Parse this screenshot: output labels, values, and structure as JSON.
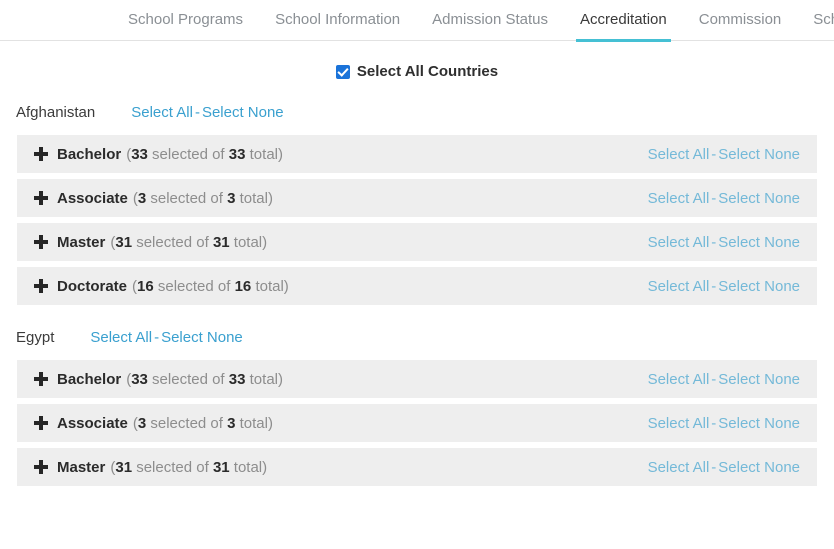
{
  "tabs": [
    {
      "label": "School Programs",
      "active": false
    },
    {
      "label": "School Information",
      "active": false
    },
    {
      "label": "Admission Status",
      "active": false
    },
    {
      "label": "Accreditation",
      "active": true
    },
    {
      "label": "Commission",
      "active": false
    },
    {
      "label": "Scholarship",
      "active": false
    }
  ],
  "select_all_countries": {
    "label": "Select All Countries",
    "checked": true
  },
  "links": {
    "select_all": "Select All",
    "select_none": "Select None",
    "separator": "-"
  },
  "countries": [
    {
      "name": "Afghanistan",
      "programs": [
        {
          "name": "Bachelor",
          "selected": "33",
          "total": "33"
        },
        {
          "name": "Associate",
          "selected": "3",
          "total": "3"
        },
        {
          "name": "Master",
          "selected": "31",
          "total": "31"
        },
        {
          "name": "Doctorate",
          "selected": "16",
          "total": "16"
        }
      ]
    },
    {
      "name": "Egypt",
      "programs": [
        {
          "name": "Bachelor",
          "selected": "33",
          "total": "33"
        },
        {
          "name": "Associate",
          "selected": "3",
          "total": "3"
        },
        {
          "name": "Master",
          "selected": "31",
          "total": "31"
        }
      ]
    }
  ],
  "count_text": {
    "open_paren": "(",
    "selected_of": " selected of ",
    "total_suffix": " total)"
  },
  "colors": {
    "active_tab_underline": "#45c0d4",
    "checkbox": "#1a73d9",
    "country_link": "#3aa0cf",
    "row_link": "#74b9d8",
    "row_background": "#eeeeee"
  }
}
